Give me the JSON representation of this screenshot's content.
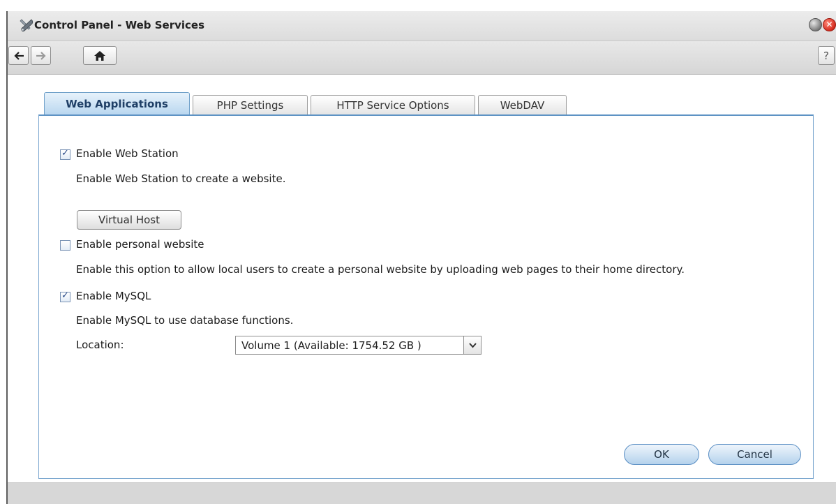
{
  "window": {
    "title": "Control Panel - Web Services"
  },
  "toolbar": {
    "help_label": "?"
  },
  "tabs": [
    {
      "label": "Web Applications",
      "active": true
    },
    {
      "label": "PHP Settings",
      "active": false
    },
    {
      "label": "HTTP Service Options",
      "active": false
    },
    {
      "label": "WebDAV",
      "active": false
    }
  ],
  "web_station": {
    "label": "Enable Web Station",
    "checked": true,
    "description": "Enable Web Station to create a website.",
    "virtual_host_label": "Virtual Host"
  },
  "personal_website": {
    "label": "Enable personal website",
    "checked": false,
    "description": "Enable this option to allow local users to create a personal website by uploading web pages to their home directory."
  },
  "mysql": {
    "label": "Enable MySQL",
    "checked": true,
    "description": "Enable MySQL to use database functions.",
    "location_label": "Location:",
    "location_value": "Volume 1 (Available: 1754.52 GB )"
  },
  "actions": {
    "ok_label": "OK",
    "cancel_label": "Cancel"
  },
  "colors": {
    "accent": "#5e93c4",
    "close": "#d52b1e"
  }
}
